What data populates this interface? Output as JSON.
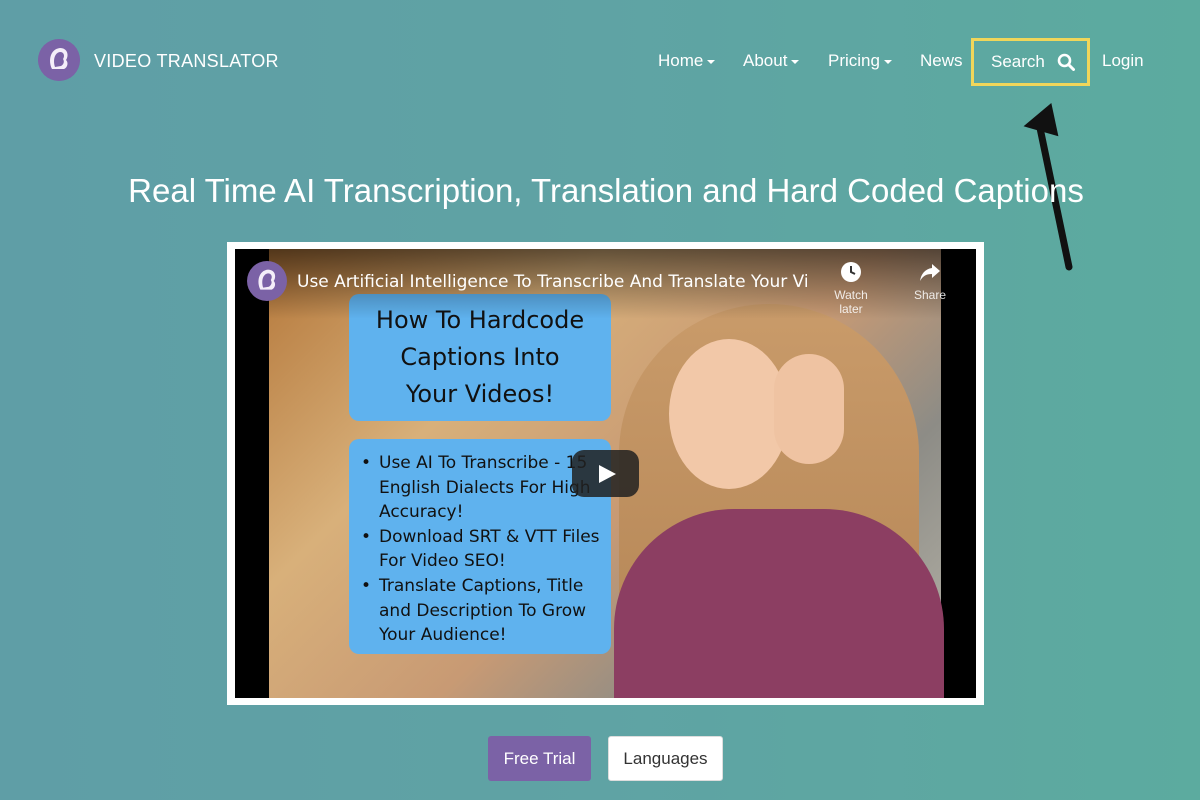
{
  "header": {
    "brand": "VIDEO TRANSLATOR",
    "nav": [
      {
        "label": "Home"
      },
      {
        "label": "About"
      },
      {
        "label": "Pricing"
      },
      {
        "label": "News"
      }
    ],
    "search_label": "Search",
    "login_label": "Login"
  },
  "hero": {
    "title": "Real Time AI Transcription, Translation and Hard Coded Captions"
  },
  "video": {
    "title": "Use Artificial Intelligence To Transcribe And Translate Your Vid...",
    "watch_later": "Watch later",
    "share": "Share",
    "card_title": [
      "How To Hardcode",
      "Captions Into",
      "Your Videos!"
    ],
    "bullets": [
      "Use AI To Transcribe - 15 English Dialects For High Accuracy!",
      "Download SRT & VTT Files For Video SEO!",
      "Translate Captions, Title and Description To Grow Your Audience!"
    ]
  },
  "actions": {
    "free_trial": "Free Trial",
    "languages": "Languages"
  },
  "colors": {
    "accent": "#7b62a6",
    "highlight": "#f0d65a"
  }
}
